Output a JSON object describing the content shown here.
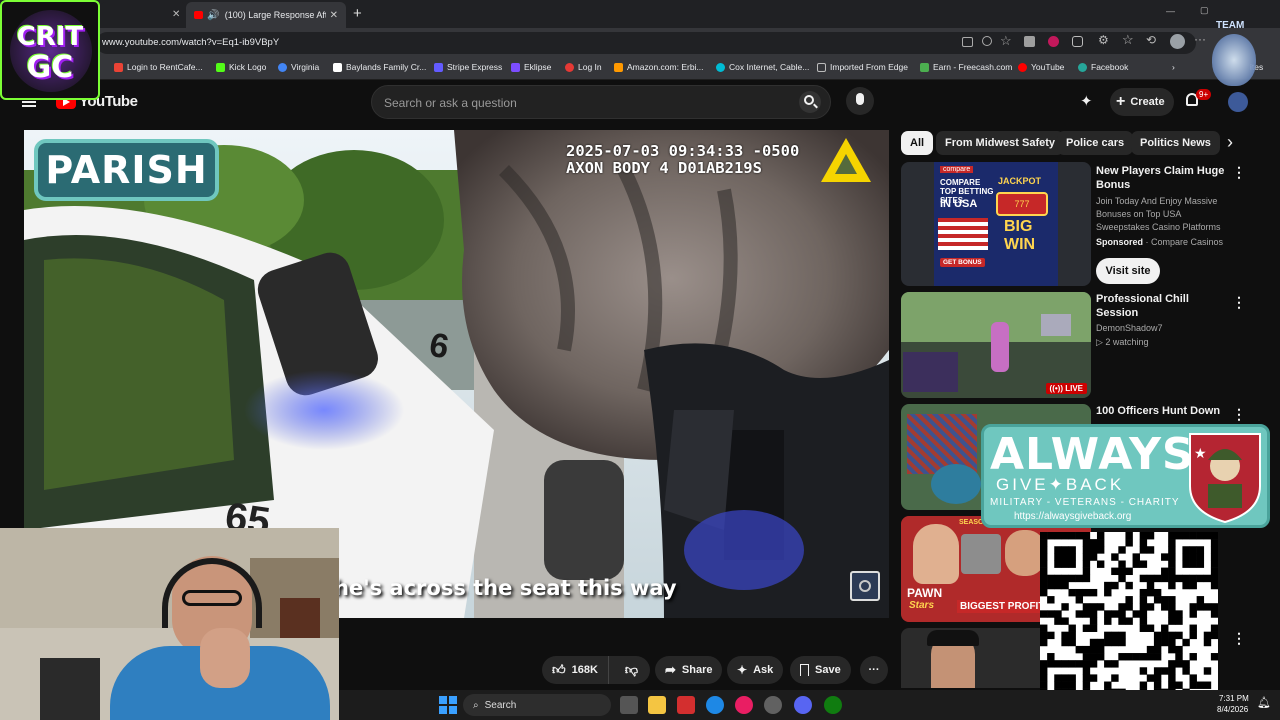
{
  "browser": {
    "tab_title": "(100) Large Response After Ki",
    "new_tab": "+",
    "window_controls": [
      "—",
      "▢",
      "✕"
    ],
    "url": "www.youtube.com/watch?v=Eq1-ib9VBpY",
    "bookmarks": [
      {
        "label": "Login to RentCafe...",
        "color": "#ea4335"
      },
      {
        "label": "Kick Logo",
        "color": "#53fc18"
      },
      {
        "label": "Virginia",
        "color": "#4285f4"
      },
      {
        "label": "Baylands Family Cr...",
        "color": "#ffffff"
      },
      {
        "label": "Stripe Express",
        "color": "#635bff"
      },
      {
        "label": "Eklipse",
        "color": "#7c4dff"
      },
      {
        "label": "Log In",
        "color": "#e53935"
      },
      {
        "label": "Amazon.com: Erbi...",
        "color": "#ff9900"
      },
      {
        "label": "Cox Internet, Cable...",
        "color": "#00bcd4"
      },
      {
        "label": "Imported From Edge",
        "color": "#9e9e9e"
      },
      {
        "label": "Earn - Freecash.com",
        "color": "#4caf50"
      },
      {
        "label": "YouTube",
        "color": "#ff0000"
      },
      {
        "label": "Facebook",
        "color": "#26a69a"
      }
    ],
    "bookmarks_overflow": "ites"
  },
  "youtube": {
    "logo_text": "YouTube",
    "search_placeholder": "Search or ask a question",
    "create_label": "Create",
    "notification_count": "9+"
  },
  "video": {
    "timestamp_line1": "2025-07-03 09:34:33 -0500",
    "timestamp_line2": "AXON BODY 4 D01AB219S",
    "overlay_badge": "PARISH",
    "caption": "he's across the seat this way",
    "car_number_fragment": "6",
    "door_number_fragment": "65"
  },
  "actions": {
    "likes": "168K",
    "share": "Share",
    "ask": "Ask",
    "save": "Save"
  },
  "chips": [
    "All",
    "From Midwest Safety",
    "Police cars",
    "Politics News"
  ],
  "ad": {
    "title": "New Players Claim Huge Bonus",
    "description": "Join Today And Enjoy Massive Bonuses on Top USA Sweepstakes Casino Platforms",
    "sponsored": "Sponsored",
    "advertiser": "Compare Casinos",
    "button": "Visit site",
    "thumb_brand": "compare",
    "thumb_headline": "COMPARE TOP BETTING SITES",
    "thumb_in_usa": "IN USA",
    "thumb_jackpot": "JACKPOT",
    "thumb_big": "BIG",
    "thumb_win": "WIN",
    "thumb_cta": "GET BONUS"
  },
  "recommendations": [
    {
      "title": "Professional Chill Session",
      "channel": "DemonShadow7",
      "meta": "2 watching",
      "badge": "LIVE"
    },
    {
      "title": "100 Officers Hunt Down",
      "channel": "",
      "meta": "",
      "badge": ""
    },
    {
      "title": "",
      "channel": "",
      "meta": "",
      "badge": ""
    },
    {
      "title": "",
      "channel": "",
      "meta": "",
      "badge": ""
    }
  ],
  "pawn_thumb": {
    "brand": "PAWN",
    "brand2": "Stars",
    "subtitle": "BIGGEST PROFIT",
    "season": "SEASON"
  },
  "promo": {
    "always": "ALWAYS",
    "give_back": "GIVE✦BACK",
    "tagline": "MILITARY - VETERANS - CHARITY",
    "url": "https://alwaysgiveback.org"
  },
  "streamer_logo": {
    "line1": "CRIT",
    "line2": "GC"
  },
  "team_logo": {
    "text": "TEAM"
  },
  "taskbar": {
    "search": "Search",
    "time": "7:31 PM",
    "date": "8/4/2026"
  },
  "colors": {
    "yt_bg": "#0f0f0f",
    "yt_red": "#ff0000",
    "chip_active": "#f1f1f1",
    "live_red": "#cc0000",
    "promo_teal": "#6fc7bf",
    "axon_yellow": "#f5d400"
  }
}
